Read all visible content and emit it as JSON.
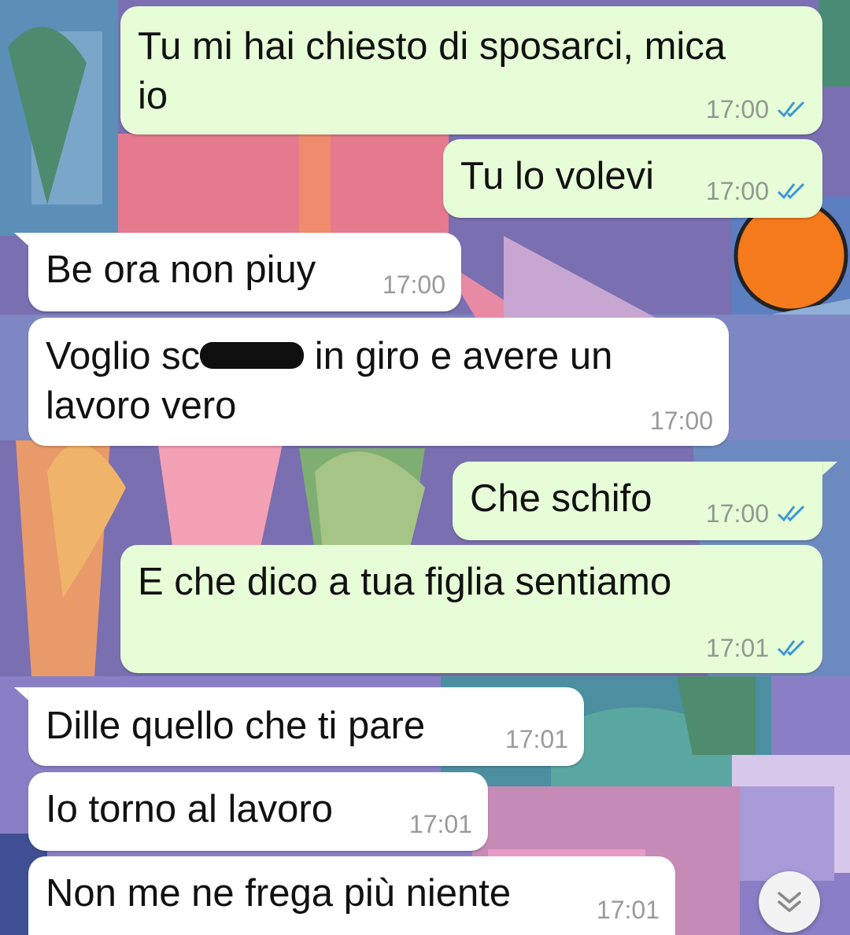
{
  "colors": {
    "outgoing_bubble": "#e6fdd7",
    "incoming_bubble": "#ffffff",
    "read_tick": "#3a97d4",
    "timestamp": "#8f9a90"
  },
  "messages": [
    {
      "direction": "outgoing",
      "lines": [
        "Tu mi hai chiesto di sposarci, mica",
        "io"
      ],
      "time": "17:00",
      "status": "read"
    },
    {
      "direction": "outgoing",
      "lines": [
        "Tu lo volevi"
      ],
      "time": "17:00",
      "status": "read"
    },
    {
      "direction": "incoming",
      "lines": [
        "Be ora non piuy"
      ],
      "time": "17:00"
    },
    {
      "direction": "incoming",
      "lines": [
        "Voglio sc",
        "in giro e avere un",
        "lavoro vero"
      ],
      "time": "17:00",
      "note": "a word is covered by a black redaction mark"
    },
    {
      "direction": "outgoing",
      "lines": [
        "Che schifo"
      ],
      "time": "17:00",
      "status": "read"
    },
    {
      "direction": "outgoing",
      "lines": [
        "E che dico a tua figlia sentiamo"
      ],
      "time": "17:01",
      "status": "read"
    },
    {
      "direction": "incoming",
      "lines": [
        "Dille quello che ti pare"
      ],
      "time": "17:01"
    },
    {
      "direction": "incoming",
      "lines": [
        "Io torno al lavoro"
      ],
      "time": "17:01"
    },
    {
      "direction": "incoming",
      "lines": [
        "Non me ne frega più niente"
      ],
      "time": "17:01"
    }
  ],
  "icons": {
    "read_receipt": "double-check-icon",
    "scroll_down": "chevron-double-down-icon"
  }
}
